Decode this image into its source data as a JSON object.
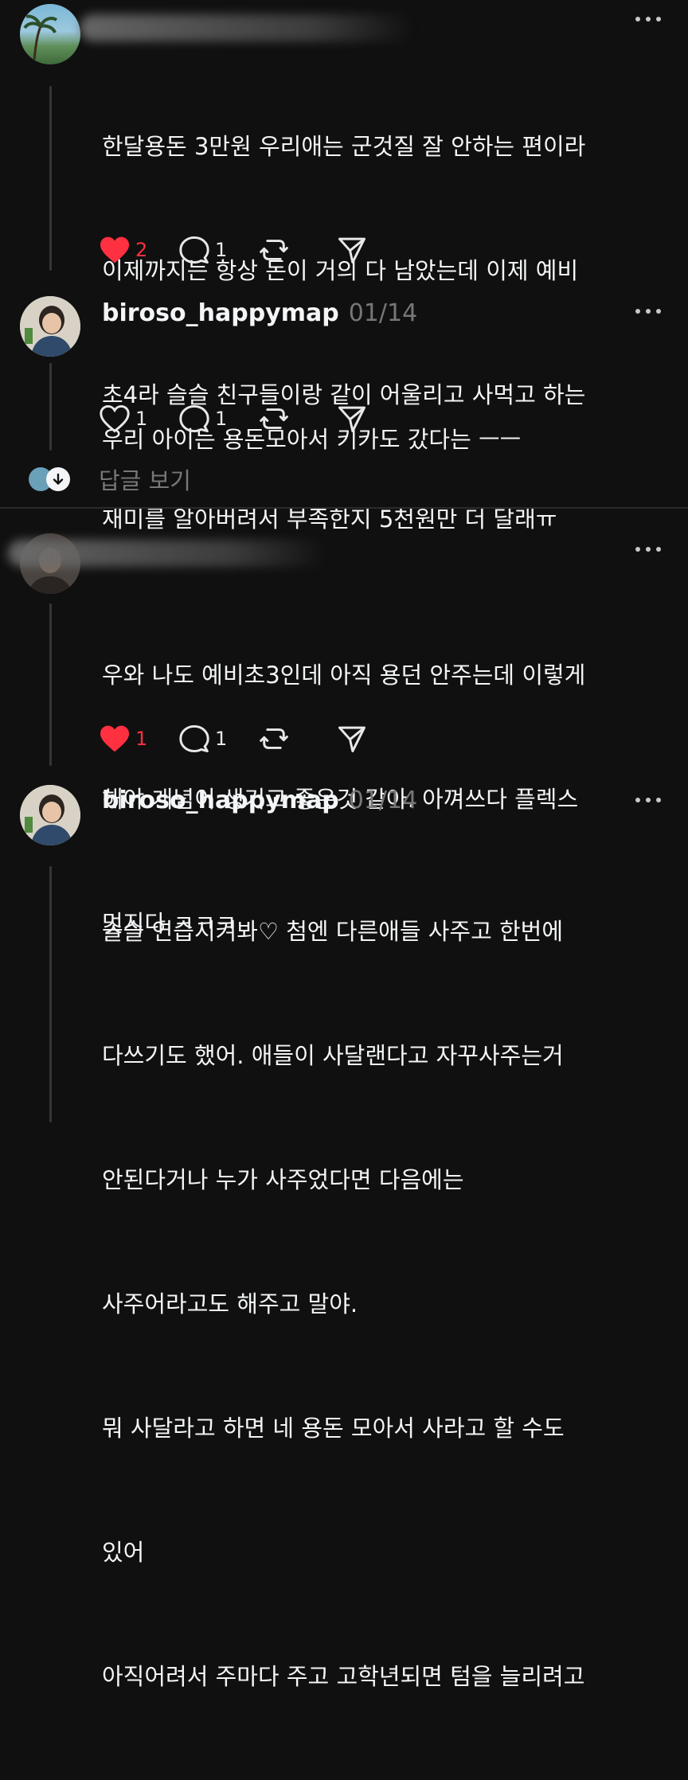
{
  "comments": [
    {
      "username": "",
      "date": "",
      "text_lines": [
        "한달용돈 3만원 우리애는 군것질 잘 안하는 편이라",
        "이제까지는 항상 돈이 거의 다 남았는데 이제 예비",
        "초4라 슬슬 친구들이랑 같이 어울리고 사먹고 하는",
        "재미를 알아버려서 부족한지 5천원만 더 달래ㅠ"
      ],
      "likes": "2",
      "liked": true,
      "replies": "1"
    },
    {
      "username": "biroso_happymap",
      "date": "01/14",
      "text_lines": [
        "우리 아이는 용돈모아서 키카도 갔다는 ㅡㅡ"
      ],
      "likes": "1",
      "liked": false,
      "replies": "1"
    },
    {
      "username": "",
      "date": "",
      "text_lines": [
        "우와 나도 예비초3인데 아직 용던 안주는데 이렇게",
        "해야 개념이 생기고 좋은것 같아. 아껴쓰다 플렉스",
        "멋지다 ㅋㅋㅋ"
      ],
      "likes": "1",
      "liked": true,
      "replies": "1"
    },
    {
      "username": "biroso_happymap",
      "date": "01/14",
      "text_lines": [
        "슬슬 연습시켜봐♡ 첨엔 다른애들 사주고 한번에",
        "다쓰기도 했어. 애들이 사달랜다고 자꾸사주는거",
        "안된다거나 누가 사주었다면 다음에는",
        "사주어라고도 해주고 말야.",
        "뭐 사달라고 하면 네 용돈 모아서 사라고 할 수도",
        "있어",
        "아직어려서 주마다 주고 고학년되면 텀을 늘리려고"
      ]
    }
  ],
  "view_replies": "답글 보기",
  "colors": {
    "like_red": "#ff3040",
    "background": "#101010",
    "text": "#f3f5f7",
    "muted": "#777777"
  },
  "icons": [
    "heart-icon",
    "comment-icon",
    "repost-icon",
    "share-icon",
    "more-icon",
    "arrow-down-icon"
  ]
}
